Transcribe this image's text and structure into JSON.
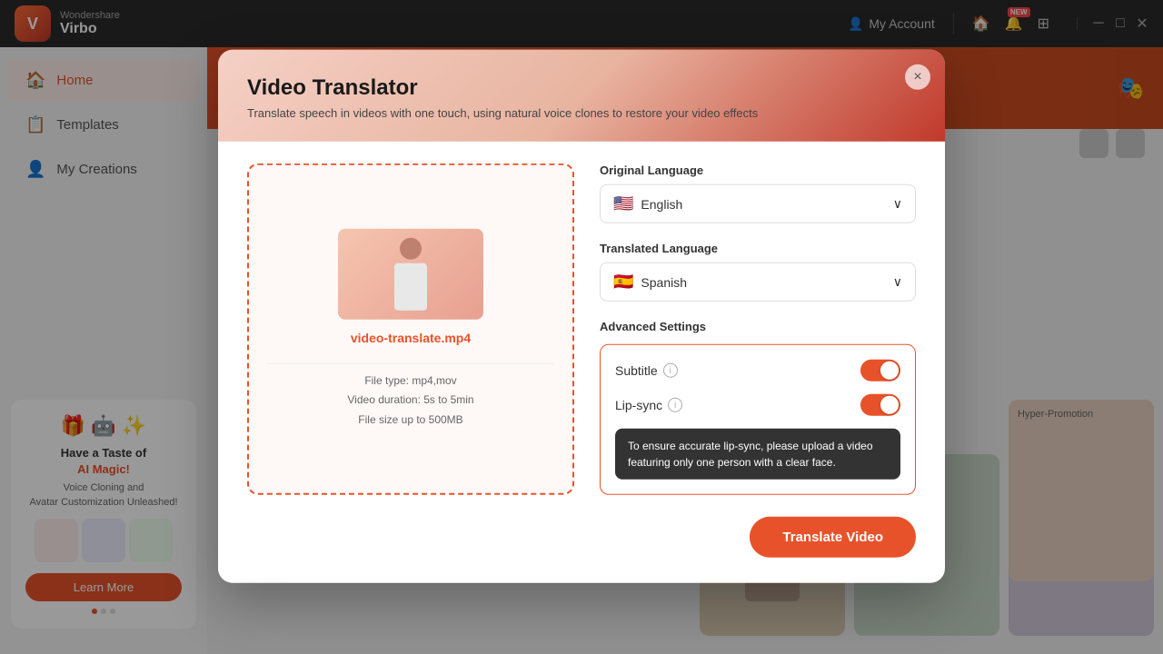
{
  "titlebar": {
    "logo": {
      "brand": "Wondershare",
      "product": "Virbo",
      "initial": "V"
    },
    "myAccount": "My Account",
    "newBadge": "NEW",
    "controls": {
      "minimize": "─",
      "restore": "□",
      "close": "✕"
    }
  },
  "sidebar": {
    "items": [
      {
        "id": "home",
        "label": "Home",
        "icon": "🏠",
        "active": true
      },
      {
        "id": "templates",
        "label": "Templates",
        "icon": "📋",
        "active": false
      },
      {
        "id": "my-creations",
        "label": "My Creations",
        "icon": "👤",
        "active": false
      }
    ],
    "promo": {
      "title_line1": "Have a Taste of",
      "title_line2": "AI Magic!",
      "subtitle": "Voice Cloning and\nAvatar Customization Unleashed!",
      "learnMore": "Learn More"
    }
  },
  "modal": {
    "title": "Video Translator",
    "subtitle": "Translate speech in videos with one touch, using natural voice clones to restore your video effects",
    "closeLabel": "×",
    "upload": {
      "filename": "video-translate.mp4",
      "fileType": "File type: mp4,mov",
      "duration": "Video duration: 5s to 5min",
      "fileSize": "File size up to  500MB"
    },
    "originalLanguage": {
      "label": "Original Language",
      "selected": "English",
      "flag": "🇺🇸"
    },
    "translatedLanguage": {
      "label": "Translated Language",
      "selected": "Spanish",
      "flag": "🇪🇸"
    },
    "advancedSettings": {
      "label": "Advanced Settings",
      "subtitle": {
        "label": "Subtitle",
        "enabled": true
      },
      "lipsync": {
        "label": "Lip-sync",
        "enabled": true
      },
      "tooltip": "To ensure accurate lip-sync, please upload a\nvideo featuring only one person with a clear face."
    },
    "translateButton": "Translate Video"
  }
}
